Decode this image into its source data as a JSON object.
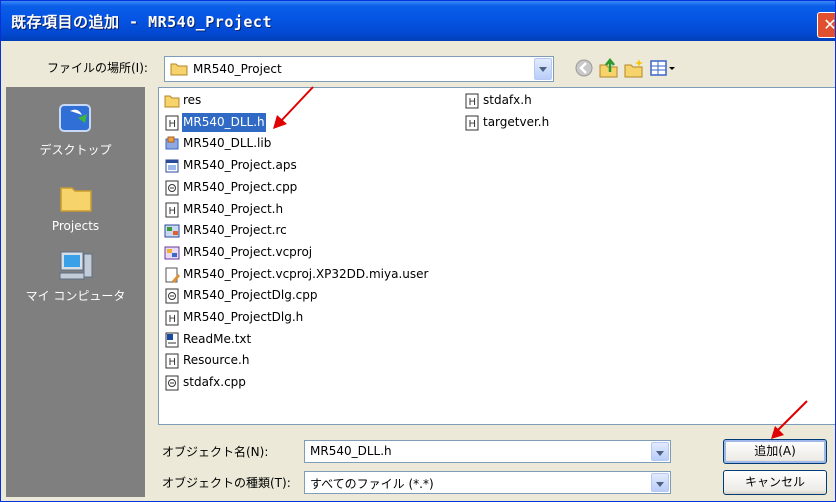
{
  "window": {
    "title": "既存項目の追加 - MR540_Project",
    "close_glyph": "✕"
  },
  "look_in": {
    "label": "ファイルの場所(I):",
    "value": "MR540_Project"
  },
  "toolbar": {
    "back_icon": "back-icon",
    "up_icon": "up-folder-icon",
    "new_folder_icon": "new-folder-icon",
    "views_icon": "views-menu-icon"
  },
  "places": [
    {
      "label": "デスクトップ",
      "icon": "desktop-icon"
    },
    {
      "label": "Projects",
      "icon": "folder-icon"
    },
    {
      "label": "マイ コンピュータ",
      "icon": "my-computer-icon"
    }
  ],
  "files_col1": [
    {
      "name": "res",
      "type": "folder"
    },
    {
      "name": "MR540_DLL.h",
      "type": "header",
      "selected": true
    },
    {
      "name": "MR540_DLL.lib",
      "type": "lib"
    },
    {
      "name": "MR540_Project.aps",
      "type": "aps"
    },
    {
      "name": "MR540_Project.cpp",
      "type": "cpp"
    },
    {
      "name": "MR540_Project.h",
      "type": "header"
    },
    {
      "name": "MR540_Project.rc",
      "type": "rc"
    },
    {
      "name": "MR540_Project.vcproj",
      "type": "vcproj"
    },
    {
      "name": "MR540_Project.vcproj.XP32DD.miya.user",
      "type": "user"
    },
    {
      "name": "MR540_ProjectDlg.cpp",
      "type": "cpp"
    },
    {
      "name": "MR540_ProjectDlg.h",
      "type": "header"
    },
    {
      "name": "ReadMe.txt",
      "type": "txt"
    },
    {
      "name": "Resource.h",
      "type": "header"
    },
    {
      "name": "stdafx.cpp",
      "type": "cpp"
    }
  ],
  "files_col2": [
    {
      "name": "stdafx.h",
      "type": "header"
    },
    {
      "name": "targetver.h",
      "type": "header"
    }
  ],
  "object_name": {
    "label": "オブジェクト名(N):",
    "value": "MR540_DLL.h"
  },
  "object_type": {
    "label": "オブジェクトの種類(T):",
    "value": "すべてのファイル (*.*)"
  },
  "buttons": {
    "add": "追加(A)",
    "cancel": "キャンセル"
  }
}
